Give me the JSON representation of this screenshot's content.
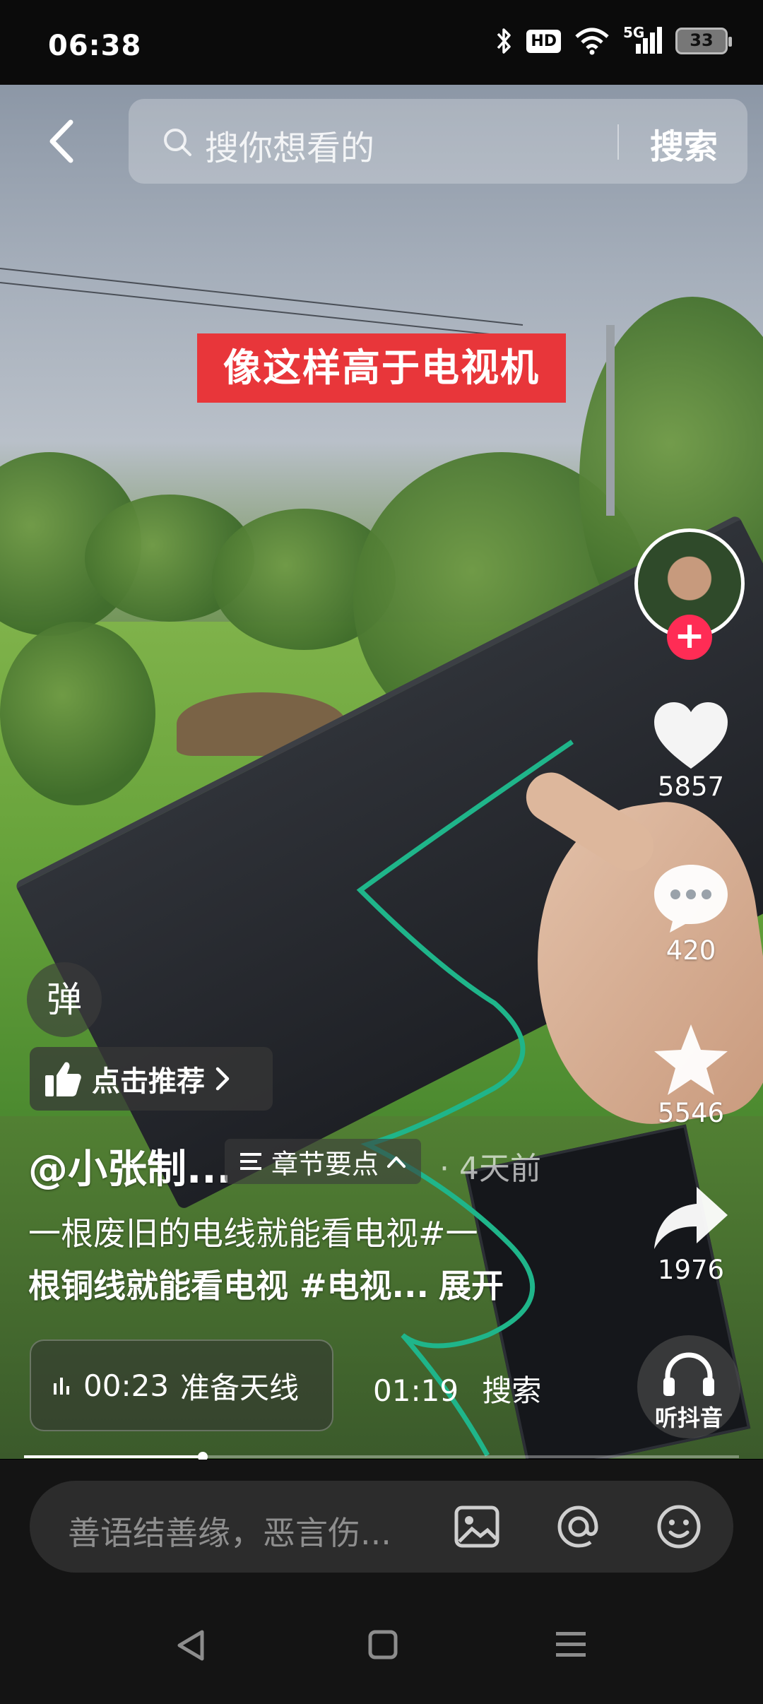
{
  "status_bar": {
    "time": "06:38",
    "network": "5G",
    "hd": "HD",
    "battery": "33"
  },
  "search": {
    "placeholder": "搜你想看的",
    "button": "搜索"
  },
  "video": {
    "caption": "像这样高于电视机"
  },
  "side_actions": {
    "likes": "5857",
    "comments": "420",
    "favorites": "5546",
    "shares": "1976",
    "listen_label": "听抖音"
  },
  "overlays": {
    "danmu_label": "弹",
    "recommend_label": "点击推荐"
  },
  "post": {
    "author": "@小张制...",
    "chapter_label": "章节要点",
    "time_ago": "· 4天前",
    "description_line1": "一根废旧的电线就能看电视#一",
    "description_line2": "根铜线就能看电视 #电视...",
    "expand": "展开"
  },
  "chapters": {
    "current_time": "00:23",
    "current_title": "准备天线",
    "next_time": "01:19",
    "next_title": "搜索"
  },
  "playback": {
    "progress_fraction": 0.25
  },
  "comment_bar": {
    "placeholder": "善语结善缘，恶言伤..."
  },
  "colors": {
    "follow": "#ff2c55",
    "caption_bg": "#e8363a"
  }
}
